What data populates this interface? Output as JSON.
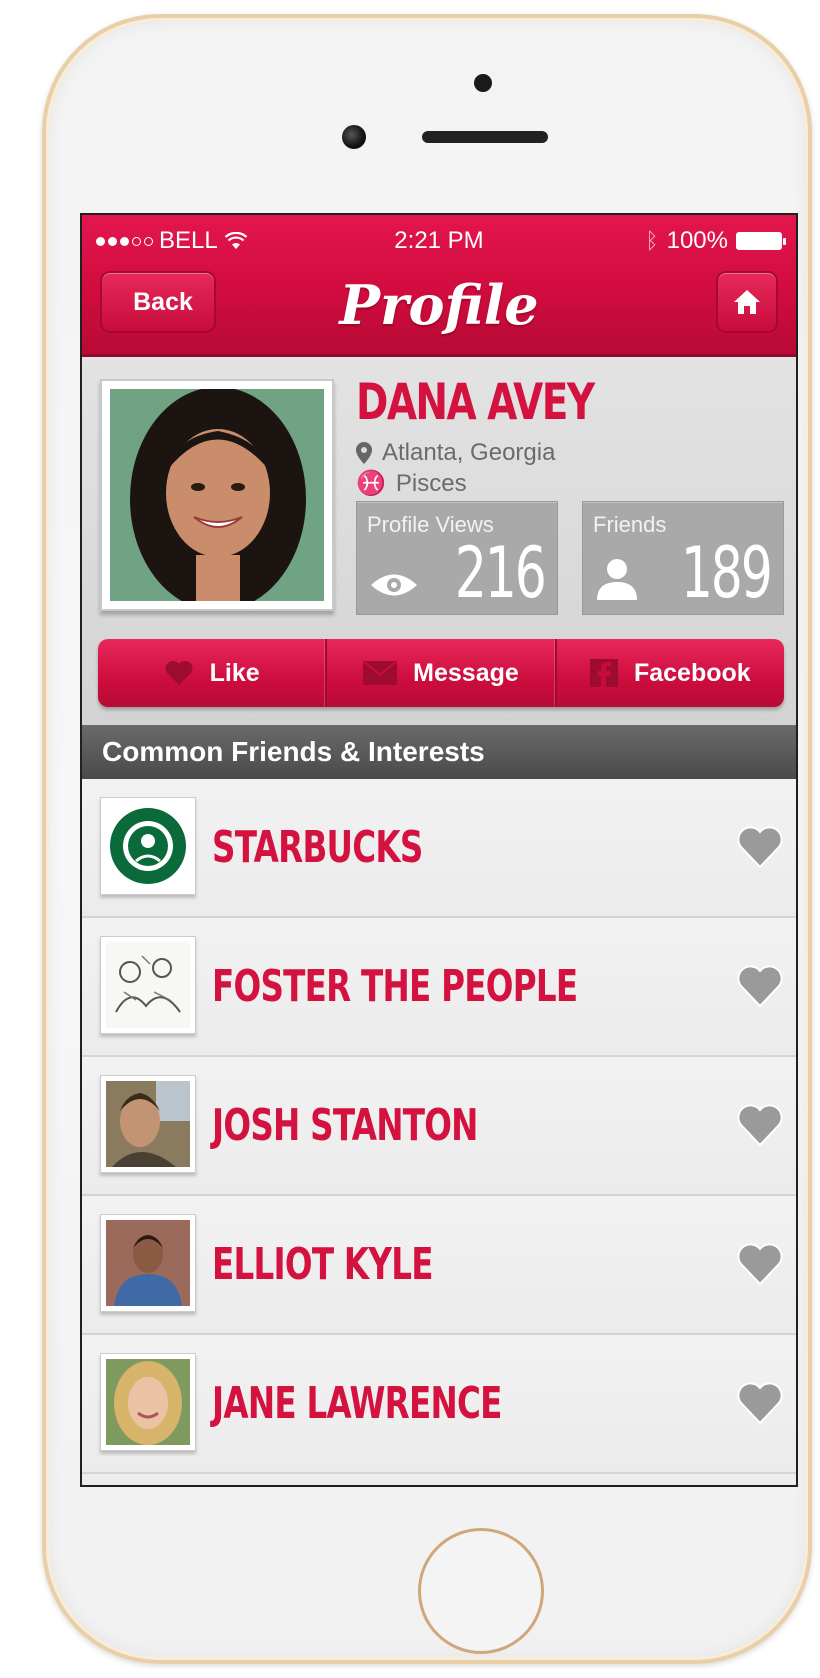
{
  "status_bar": {
    "carrier": "BELL",
    "time": "2:21 PM",
    "battery": "100%"
  },
  "nav": {
    "back_label": "Back",
    "title": "Profile"
  },
  "profile": {
    "name": "DANA AVEY",
    "location": "Atlanta, Georgia",
    "sign": "Pisces",
    "stats": {
      "views_label": "Profile Views",
      "views_value": "216",
      "friends_label": "Friends",
      "friends_value": "189"
    }
  },
  "actions": {
    "like": "Like",
    "message": "Message",
    "facebook": "Facebook"
  },
  "section": {
    "title": "Common Friends & Interests"
  },
  "interests": [
    {
      "label": "STARBUCKS",
      "kind": "brand"
    },
    {
      "label": "FOSTER THE PEOPLE",
      "kind": "band"
    },
    {
      "label": "JOSH STANTON",
      "kind": "person"
    },
    {
      "label": "ELLIOT KYLE",
      "kind": "person"
    },
    {
      "label": "JANE LAWRENCE",
      "kind": "person"
    }
  ],
  "colors": {
    "accent": "#d3123f",
    "header": "#d10c3f",
    "stat_box": "#a9a9a9",
    "section_header": "#4a4a4a",
    "heart": "#9a9a9a"
  },
  "icons": {
    "location": "map-pin-icon",
    "sign": "pisces-icon",
    "views": "eye-icon",
    "friends": "person-icon",
    "like": "heart-icon",
    "message": "envelope-icon",
    "facebook": "facebook-icon",
    "home": "home-icon",
    "favorite": "heart-icon"
  }
}
